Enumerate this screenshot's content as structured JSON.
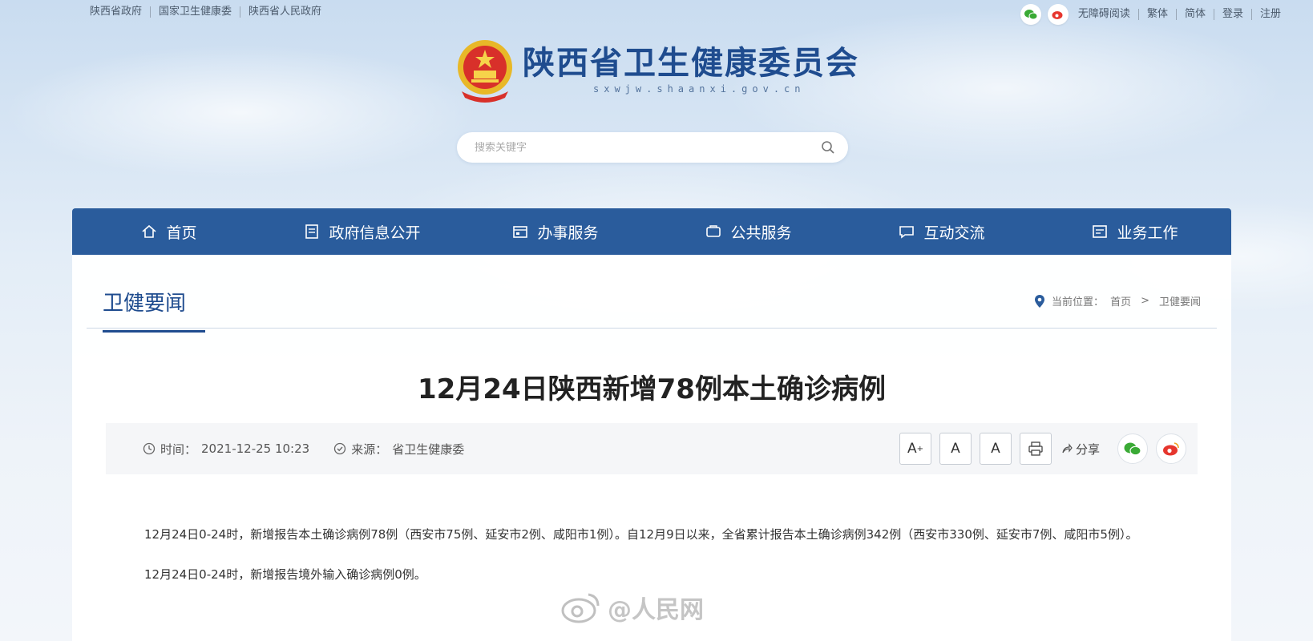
{
  "top": {
    "left_links": [
      "陕西省政府",
      "国家卫生健康委",
      "陕西省人民政府"
    ],
    "right_links": [
      "无障碍阅读",
      "繁体",
      "简体",
      "登录",
      "注册"
    ]
  },
  "brand": {
    "name": "陕西省卫生健康委员会",
    "domain": "sxwjw.shaanxi.gov.cn"
  },
  "search": {
    "placeholder": "搜索关键字"
  },
  "nav": [
    {
      "label": "首页",
      "icon": "home-icon"
    },
    {
      "label": "政府信息公开",
      "icon": "document-icon"
    },
    {
      "label": "办事服务",
      "icon": "service-icon"
    },
    {
      "label": "公共服务",
      "icon": "public-service-icon"
    },
    {
      "label": "互动交流",
      "icon": "chat-icon"
    },
    {
      "label": "业务工作",
      "icon": "work-icon"
    }
  ],
  "section": {
    "title": "卫健要闻",
    "crumb_prefix": "当前位置：",
    "crumb_home": "首页",
    "crumb_sep": ">",
    "crumb_current": "卫健要闻"
  },
  "article": {
    "title": "12月24日陕西新增78例本土确诊病例",
    "time_label": "时间：",
    "time": "2021-12-25 10:23",
    "source_label": "来源：",
    "source": "省卫生健康委",
    "font_large": "A",
    "font_medium": "A",
    "font_small": "A",
    "share_label": "分享",
    "paragraphs": [
      "12月24日0-24时，新增报告本土确诊病例78例（西安市75例、延安市2例、咸阳市1例）。自12月9日以来，全省累计报告本土确诊病例342例（西安市330例、延安市7例、咸阳市5例）。",
      "12月24日0-24时，新增报告境外输入确诊病例0例。"
    ]
  },
  "watermark": "@人民网",
  "colors": {
    "nav_bg": "#2a5c9c",
    "brand": "#1f4c8f"
  }
}
